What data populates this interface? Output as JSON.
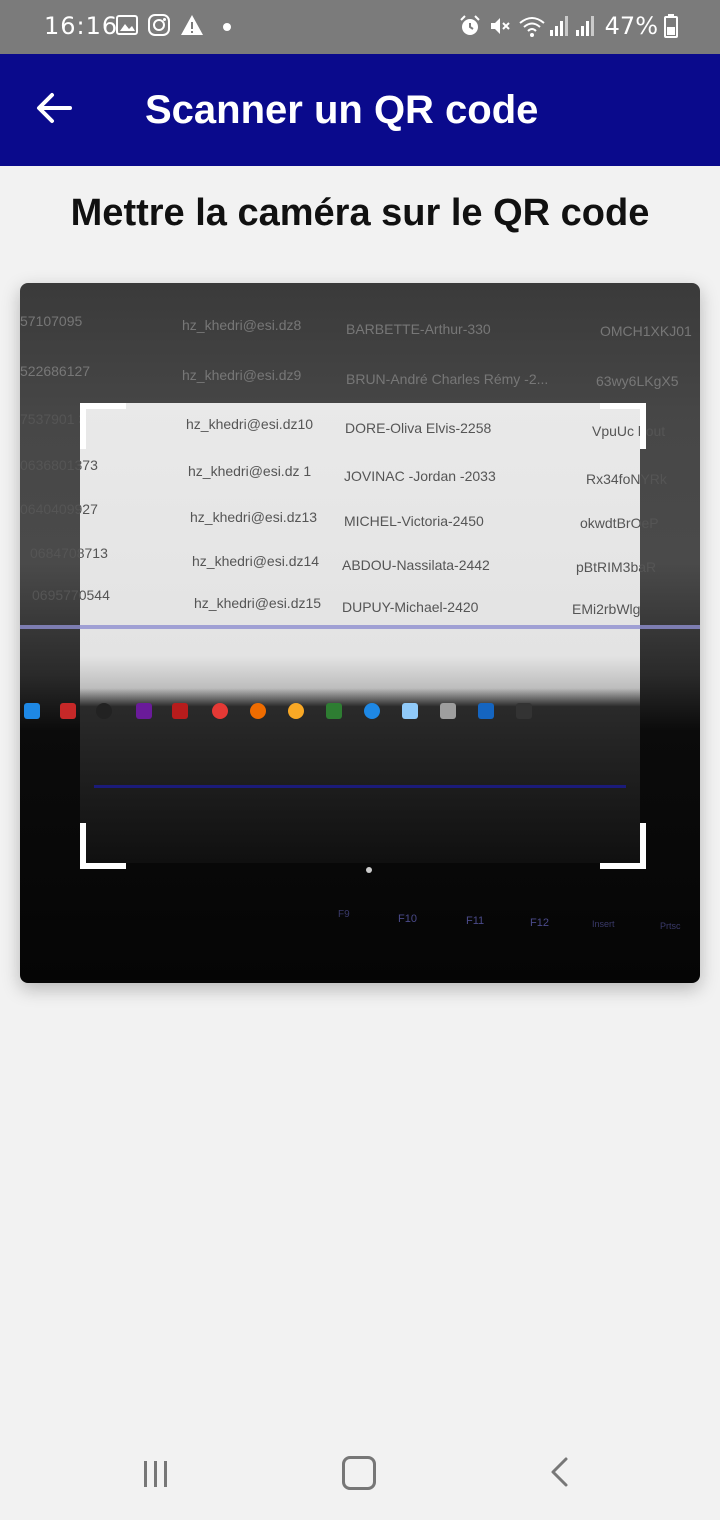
{
  "status_bar": {
    "time": "16:16",
    "battery": "47%",
    "left_icons": [
      "gallery-icon",
      "instagram-icon",
      "warning-icon",
      "dot-icon"
    ],
    "right_icons": [
      "alarm-icon",
      "mute-icon",
      "wifi-icon",
      "signal-icon",
      "signal-icon",
      "battery-icon"
    ]
  },
  "app_bar": {
    "title": "Scanner un QR code",
    "background": "#0a0a8c"
  },
  "instruction": "Mettre la caméra sur le QR code",
  "camera_preview": {
    "rows": [
      {
        "phone": "57107095",
        "email": "hz_khedri@esi.dz8",
        "name": "BARBETTE-Arthur-330",
        "code": "OMCH1XKJ01"
      },
      {
        "phone": "522686127",
        "email": "hz_khedri@esi.dz9",
        "name": "BRUN-André Charles Rémy -2...",
        "code": "63wy6LKgX5"
      },
      {
        "phone": "7537901 3",
        "email": "hz_khedri@esi.dz10",
        "name": "DORE-Oliva Elvis-2258",
        "code": "VpuUc bout"
      },
      {
        "phone": "0636801373",
        "email": "hz_khedri@esi.dz 1",
        "name": "JOVINAC -Jordan -2033",
        "code": "Rx34foNYRk"
      },
      {
        "phone": "0640409927",
        "email": "hz_khedri@esi.dz13",
        "name": "MICHEL-Victoria-2450",
        "code": "okwdtBrOeP"
      },
      {
        "phone": "0684708713",
        "email": "hz_khedri@esi.dz14",
        "name": "ABDOU-Nassilata-2442",
        "code": "pBtRIM3baR"
      },
      {
        "phone": "0695770544",
        "email": "hz_khedri@esi.dz15",
        "name": "DUPUY-Michael-2420",
        "code": "EMi2rbWlg"
      }
    ],
    "keyboard_keys": [
      "F9",
      "F10",
      "F11",
      "F12",
      "Insert",
      "Prtsc"
    ]
  },
  "nav_bar": {
    "recent_icon": "recent-apps-icon",
    "home_icon": "home-icon",
    "back_icon": "back-nav-icon"
  }
}
